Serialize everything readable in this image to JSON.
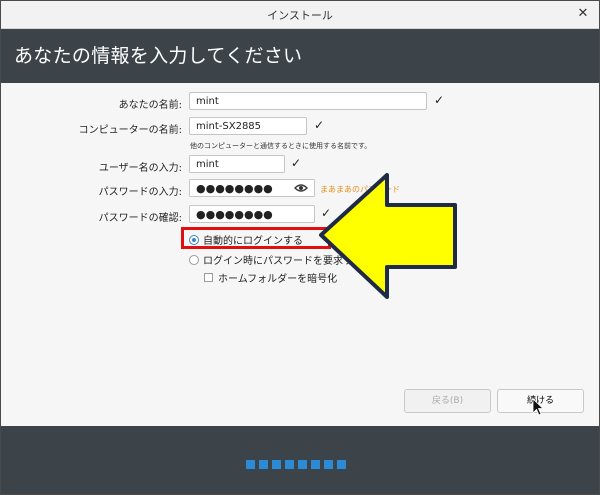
{
  "window": {
    "title": "インストール"
  },
  "header": {
    "title": "あなたの情報を入力してください"
  },
  "form": {
    "name": {
      "label": "あなたの名前:",
      "value": "mint"
    },
    "computer": {
      "label": "コンピューターの名前:",
      "value": "mint-SX2885",
      "hint": "他のコンピューターと通信するときに使用する名前です。"
    },
    "username": {
      "label": "ユーザー名の入力:",
      "value": "mint"
    },
    "password": {
      "label": "パスワードの入力:",
      "value": "●●●●●●●●",
      "strength": "まあまあのパスワード"
    },
    "confirm": {
      "label": "パスワードの確認:",
      "value": "●●●●●●●●"
    },
    "check_mark": "✓"
  },
  "login": {
    "auto_label": "自動的にログインする",
    "require_label": "ログイン時にパスワードを要求する",
    "encrypt_label": "ホームフォルダーを暗号化"
  },
  "buttons": {
    "back": "戻る(B)",
    "continue": "続ける"
  },
  "colors": {
    "header_bg": "#3d4449",
    "highlight": "#e01010",
    "arrow_fill": "#ffff00",
    "dot": "#2d8bd6"
  },
  "progress": {
    "total_steps": 8
  }
}
